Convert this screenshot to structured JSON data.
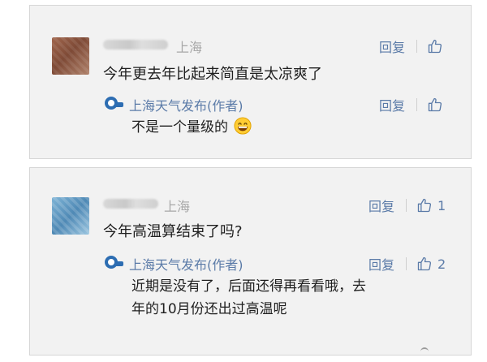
{
  "comments": [
    {
      "location": "上海",
      "text": "今年更去年比起来简直是太凉爽了",
      "reply_label": "回复",
      "like_count": "",
      "reply": {
        "author": "上海天气发布(作者)",
        "text": "不是一个量级的",
        "reply_label": "回复",
        "like_count": ""
      }
    },
    {
      "location": "上海",
      "text": "今年高温算结束了吗?",
      "reply_label": "回复",
      "like_count": "1",
      "reply": {
        "author": "上海天气发布(作者)",
        "text_line1": "近期是没有了，后面还得再看看哦，去",
        "text_line2": "年的10月份还出过高温呢",
        "reply_label": "回复",
        "like_count": "2"
      }
    }
  ],
  "icons": {
    "like": "thumbs-up-icon",
    "emoji": "grinning-face-emoji-icon",
    "logo": "weather-logo-icon"
  },
  "colors": {
    "link": "#5b7ba8",
    "card_bg": "#f2f2f2"
  }
}
